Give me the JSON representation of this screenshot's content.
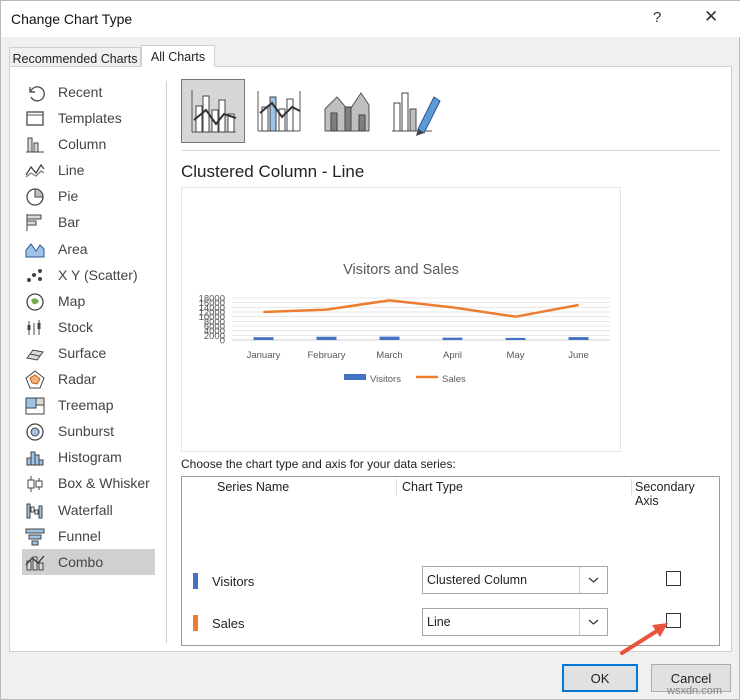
{
  "window": {
    "title": "Change Chart Type",
    "help_label": "?",
    "close_label": "✕"
  },
  "tabs": [
    {
      "label": "Recommended Charts"
    },
    {
      "label": "All Charts"
    }
  ],
  "chart_types": [
    {
      "label": "Recent",
      "icon": "recent-icon"
    },
    {
      "label": "Templates",
      "icon": "templates-icon"
    },
    {
      "label": "Column",
      "icon": "column-chart-icon"
    },
    {
      "label": "Line",
      "icon": "line-chart-icon"
    },
    {
      "label": "Pie",
      "icon": "pie-chart-icon"
    },
    {
      "label": "Bar",
      "icon": "bar-chart-icon"
    },
    {
      "label": "Area",
      "icon": "area-chart-icon"
    },
    {
      "label": "X Y (Scatter)",
      "icon": "scatter-chart-icon"
    },
    {
      "label": "Map",
      "icon": "map-chart-icon"
    },
    {
      "label": "Stock",
      "icon": "stock-chart-icon"
    },
    {
      "label": "Surface",
      "icon": "surface-chart-icon"
    },
    {
      "label": "Radar",
      "icon": "radar-chart-icon"
    },
    {
      "label": "Treemap",
      "icon": "treemap-chart-icon"
    },
    {
      "label": "Sunburst",
      "icon": "sunburst-chart-icon"
    },
    {
      "label": "Histogram",
      "icon": "histogram-chart-icon"
    },
    {
      "label": "Box & Whisker",
      "icon": "box-whisker-chart-icon"
    },
    {
      "label": "Waterfall",
      "icon": "waterfall-chart-icon"
    },
    {
      "label": "Funnel",
      "icon": "funnel-chart-icon"
    },
    {
      "label": "Combo",
      "icon": "combo-chart-icon",
      "selected": true
    }
  ],
  "subtype": {
    "title": "Clustered Column - Line"
  },
  "instruction": "Choose the chart type and axis for your data series:",
  "series_grid": {
    "headers": {
      "series_name": "Series Name",
      "chart_type": "Chart Type",
      "secondary_axis": "Secondary Axis"
    },
    "rows": [
      {
        "name": "Visitors",
        "color": "#4472c4",
        "chart_type": "Clustered Column",
        "secondary_axis": false
      },
      {
        "name": "Sales",
        "color": "#ed7d31",
        "chart_type": "Line",
        "secondary_axis": false
      }
    ]
  },
  "buttons": {
    "ok": "OK",
    "cancel": "Cancel"
  },
  "watermark": "wsxdn.com",
  "colors": {
    "visitors": "#4472c4",
    "sales": "#ed7d31",
    "arrow": "#e8533b",
    "selected_item": "#d0d0d0"
  },
  "chart_data": {
    "type": "bar",
    "title": "Visitors and Sales",
    "categories": [
      "January",
      "February",
      "March",
      "April",
      "May",
      "June"
    ],
    "series": [
      {
        "name": "Visitors",
        "type": "bar",
        "values": [
          1200,
          1400,
          1450,
          1000,
          900,
          1250
        ]
      },
      {
        "name": "Sales",
        "type": "line",
        "values": [
          12000,
          13000,
          17000,
          14000,
          10000,
          15000
        ]
      }
    ],
    "yticks": [
      0,
      2000,
      4000,
      6000,
      8000,
      10000,
      12000,
      14000,
      16000,
      18000
    ],
    "ylim": [
      0,
      18000
    ],
    "xlabel": "",
    "ylabel": "",
    "grid": true,
    "legend_position": "bottom"
  }
}
